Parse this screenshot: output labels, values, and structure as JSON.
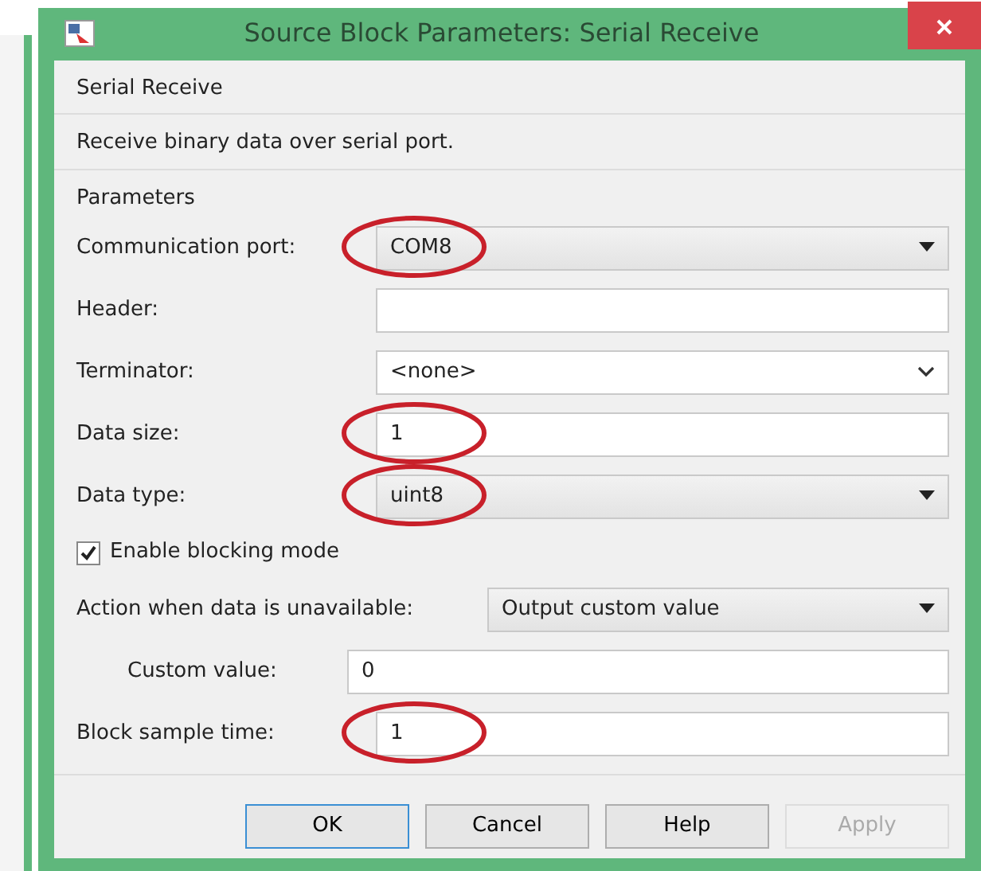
{
  "window": {
    "title": "Source Block Parameters: Serial Receive"
  },
  "block_name": "Serial Receive",
  "description": "Receive binary data over serial port.",
  "section": "Parameters",
  "fields": [
    {
      "kind": "dropdown",
      "label": "Communication port:",
      "value": "COM8",
      "circled": true
    },
    {
      "kind": "text",
      "label": "Header:"
    },
    {
      "kind": "combo",
      "label": "Terminator:",
      "value": "<none>"
    },
    {
      "kind": "text",
      "label": "Data size:",
      "value": "1",
      "circled": true
    },
    {
      "kind": "dropdown",
      "label": "Data type:",
      "value": "uint8",
      "circled": true
    },
    {
      "kind": "checkbox",
      "label": "Enable blocking mode",
      "checked": true
    },
    {
      "kind": "dropdown",
      "label": "Action when data is unavailable:",
      "value": "Output custom value",
      "wide_label": true
    },
    {
      "kind": "text",
      "label": "Custom value:",
      "value": "0",
      "indented": true
    },
    {
      "kind": "text",
      "label": "Block sample time:",
      "value": "1",
      "circled": true
    }
  ],
  "buttons": [
    {
      "label": "OK",
      "disabled": false,
      "focused": true
    },
    {
      "label": "Cancel",
      "disabled": false,
      "focused": false
    },
    {
      "label": "Help",
      "disabled": false,
      "focused": false
    },
    {
      "label": "Apply",
      "disabled": true,
      "focused": false
    }
  ]
}
